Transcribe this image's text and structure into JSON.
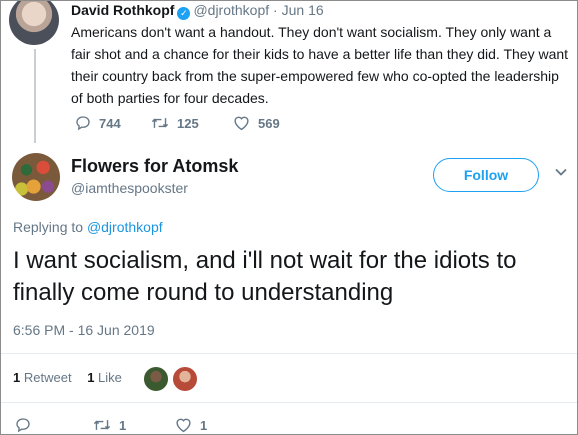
{
  "parent_tweet": {
    "name": "David Rothkopf",
    "handle": "@djrothkopf",
    "separator": "·",
    "date": "Jun 16",
    "text": "Americans don't want a handout.  They don't want socialism.  They only want a fair shot and a chance for their kids to have a better life than they did.  They want their country back from the super-empowered few who co-opted the leadership of both parties for four decades.",
    "replies": "744",
    "retweets": "125",
    "likes": "569",
    "verified_icon": "verified-badge-icon"
  },
  "main_tweet": {
    "name": "Flowers for Atomsk",
    "handle": "@iamthespookster",
    "follow_label": "Follow",
    "replying_to_prefix": "Replying to ",
    "replying_to_handle": "@djrothkopf",
    "text": "I want socialism, and i'll not wait for the idiots to finally come round to understanding",
    "timestamp": "6:56 PM - 16 Jun 2019",
    "retweet_count": "1",
    "retweet_label": "Retweet",
    "like_count": "1",
    "like_label": "Like",
    "reply_count": "",
    "bottom_retweets": "1",
    "bottom_likes": "1"
  },
  "colors": {
    "accent": "#1da1f2",
    "text": "#14171a",
    "muted": "#657786",
    "divider": "#e6ecf0",
    "thread_line": "#c4cfd6"
  }
}
